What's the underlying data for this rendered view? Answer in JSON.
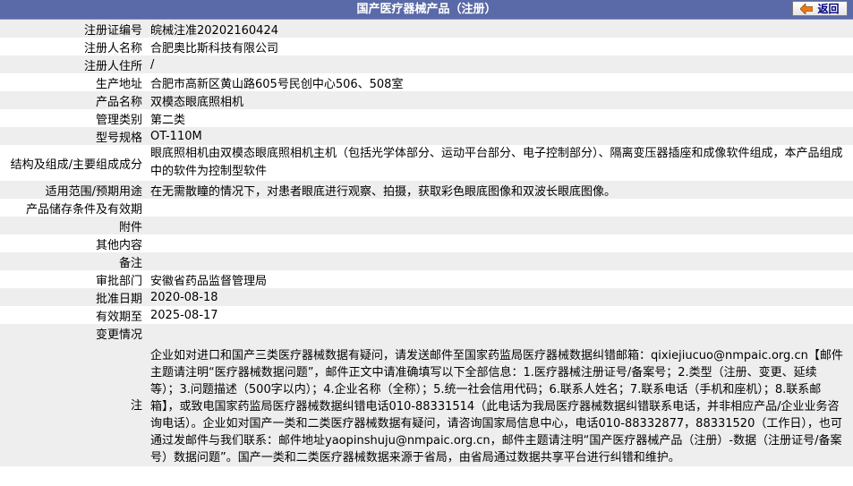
{
  "header": {
    "title": "国产医疗器械产品（注册）",
    "back_label": "返回"
  },
  "fields": [
    {
      "label": "注册证编号",
      "value": "皖械注准20202160424"
    },
    {
      "label": "注册人名称",
      "value": "合肥奥比斯科技有限公司"
    },
    {
      "label": "注册人住所",
      "value": "/"
    },
    {
      "label": "生产地址",
      "value": "合肥市高新区黄山路605号民创中心506、508室"
    },
    {
      "label": "产品名称",
      "value": "双模态眼底照相机"
    },
    {
      "label": "管理类别",
      "value": "第二类"
    },
    {
      "label": "型号规格",
      "value": "OT-110M"
    },
    {
      "label": "结构及组成/主要组成成分",
      "value": "眼底照相机由双模态眼底照相机主机（包括光学体部分、运动平台部分、电子控制部分）、隔离变压器插座和成像软件组成，本产品组成中的软件为控制型软件"
    },
    {
      "label": "适用范围/预期用途",
      "value": "在无需散瞳的情况下，对患者眼底进行观察、拍摄，获取彩色眼底图像和双波长眼底图像。"
    },
    {
      "label": "产品储存条件及有效期",
      "value": ""
    },
    {
      "label": "附件",
      "value": ""
    },
    {
      "label": "其他内容",
      "value": ""
    },
    {
      "label": "备注",
      "value": ""
    },
    {
      "label": "审批部门",
      "value": "安徽省药品监督管理局"
    },
    {
      "label": "批准日期",
      "value": "2020-08-18"
    },
    {
      "label": "有效期至",
      "value": "2025-08-17"
    },
    {
      "label": "变更情况",
      "value": ""
    }
  ],
  "note": {
    "label": "注",
    "text": "企业如对进口和国产三类医疗器械数据有疑问，请发送邮件至国家药监局医疗器械数据纠错邮箱：qixiejiucuo@nmpaic.org.cn【邮件主题请注明“医疗器械数据问题”，邮件正文中请准确填写以下全部信息：1.医疗器械注册证号/备案号；2.类型（注册、变更、延续等）；3.问题描述（500字以内）；4.企业名称（全称）；5.统一社会信用代码；6.联系人姓名；7.联系电话（手机和座机）；8.联系邮箱】，或致电国家药监局医疗器械数据纠错电话010-88331514（此电话为我局医疗器械数据纠错联系电话，并非相应产品/企业业务咨询电话）。企业如对国产一类和二类医疗器械数据有疑问，请咨询国家局信息中心，电话010-88332877，88331520（工作日），也可通过发邮件与我们联系：邮件地址yaopinshuju@nmpaic.org.cn，邮件主题请注明“国产医疗器械产品（注册）-数据（注册证号/备案号）数据问题”。国产一类和二类医疗器械数据来源于省局，由省局通过数据共享平台进行纠错和维护。"
  }
}
